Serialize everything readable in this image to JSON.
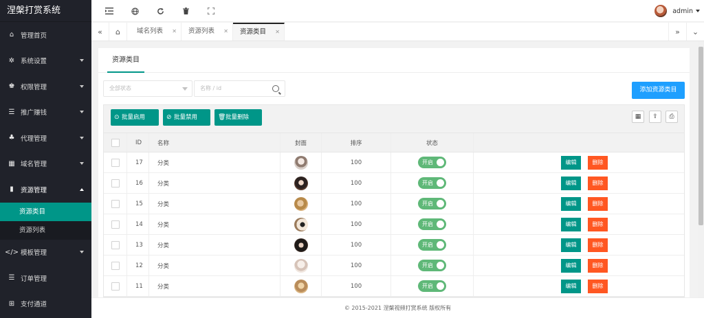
{
  "app": {
    "title": "涅槃打赏系统"
  },
  "sidebar": {
    "items": [
      {
        "label": "管理首页",
        "icon": "home-icon",
        "glyph": "⌂",
        "has_caret": false
      },
      {
        "label": "系统设置",
        "icon": "gear-icon",
        "glyph": "✲",
        "has_caret": true
      },
      {
        "label": "权限管理",
        "icon": "users-icon",
        "glyph": "♚",
        "has_caret": true
      },
      {
        "label": "推广赚钱",
        "icon": "list-icon",
        "glyph": "☰",
        "has_caret": true
      },
      {
        "label": "代理管理",
        "icon": "group-icon",
        "glyph": "♣",
        "has_caret": true
      },
      {
        "label": "域名管理",
        "icon": "grid-icon",
        "glyph": "▦",
        "has_caret": true
      },
      {
        "label": "资源管理",
        "icon": "book-icon",
        "glyph": "▮",
        "has_caret": true,
        "open": true
      },
      {
        "label": "模板管理",
        "icon": "code-icon",
        "glyph": "</>",
        "has_caret": true
      },
      {
        "label": "订单管理",
        "icon": "list-icon",
        "glyph": "☰",
        "has_caret": false
      },
      {
        "label": "支付通道",
        "icon": "apps-icon",
        "glyph": "⊞",
        "has_caret": false
      }
    ],
    "submenu": [
      {
        "label": "资源类目",
        "active": true
      },
      {
        "label": "资源列表",
        "active": false
      }
    ]
  },
  "header": {
    "icons": [
      "menu-fold-icon",
      "globe-icon",
      "refresh-icon",
      "trash-icon",
      "fullscreen-icon"
    ],
    "user": {
      "name": "admin"
    }
  },
  "tabs": {
    "items": [
      {
        "label": "域名列表",
        "active": false
      },
      {
        "label": "资源列表",
        "active": false
      },
      {
        "label": "资源类目",
        "active": true
      }
    ]
  },
  "page": {
    "tab": "资源类目",
    "filter": {
      "status_placeholder": "全部状态",
      "search_placeholder": "名称 / id"
    },
    "add_button": "添加资源类目",
    "toolbar": {
      "enable_label": "批量启用",
      "disable_label": "批量禁用",
      "delete_label": "批量删除"
    },
    "table": {
      "columns": {
        "id": "ID",
        "name": "名称",
        "cover": "封面",
        "sort": "排序",
        "status": "状态"
      },
      "rows": [
        {
          "id": "17",
          "name": "分类",
          "sort": "100",
          "status": "开启"
        },
        {
          "id": "16",
          "name": "分类",
          "sort": "100",
          "status": "开启"
        },
        {
          "id": "15",
          "name": "分类",
          "sort": "100",
          "status": "开启"
        },
        {
          "id": "14",
          "name": "分类",
          "sort": "100",
          "status": "开启"
        },
        {
          "id": "13",
          "name": "分类",
          "sort": "100",
          "status": "开启"
        },
        {
          "id": "12",
          "name": "分类",
          "sort": "100",
          "status": "开启"
        },
        {
          "id": "11",
          "name": "分类",
          "sort": "100",
          "status": "开启"
        }
      ],
      "edit_label": "编辑",
      "delete_label": "删除"
    }
  },
  "footer": {
    "text": "© 2015-2021 涅槃视频打赏系统 版权所有"
  },
  "colors": {
    "primary": "#009688",
    "blue": "#1e9fff",
    "danger": "#ff5722",
    "switch": "#5fb878",
    "sidebar": "#20222a"
  }
}
